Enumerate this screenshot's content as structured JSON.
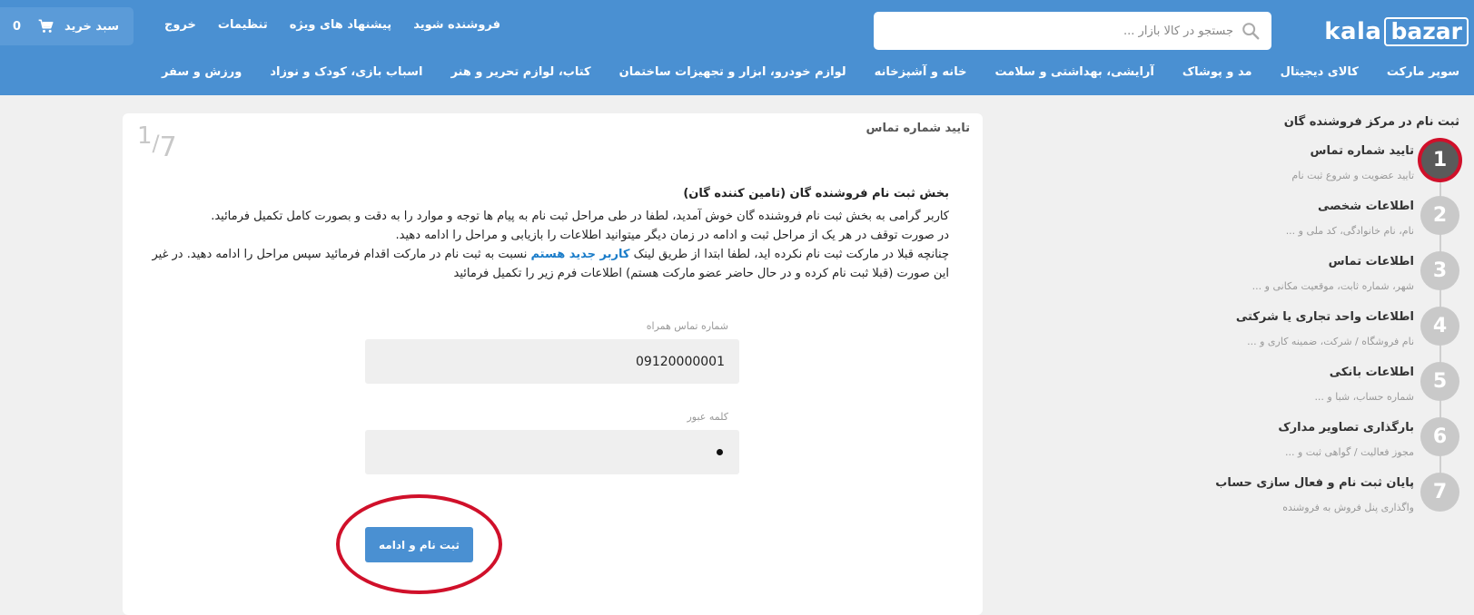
{
  "header": {
    "logo": {
      "part1": "kala",
      "part2": "bazar"
    },
    "search_placeholder": "جستجو در کالا بازار ...",
    "links": [
      "فروشنده شوید",
      "پیشنهاد های ویژه",
      "تنظیمات",
      "خروج"
    ],
    "cart": {
      "label": "سبد خرید",
      "count": "0"
    },
    "categories": [
      "سوپر مارکت",
      "کالای دیجیتال",
      "مد و پوشاک",
      "آرایشی، بهداشتی و سلامت",
      "خانه و آشپزخانه",
      "لوازم خودرو، ابزار و تجهیزات ساختمان",
      "کتاب، لوازم تحریر و هنر",
      "اسباب بازی، کودک و نوزاد",
      "ورزش و سفر"
    ]
  },
  "sidebar": {
    "title": "ثبت نام در مرکز فروشنده گان",
    "steps": [
      {
        "num": "1",
        "title": "تایید شماره تماس",
        "sub": "تایید عضویت و شروع ثبت نام"
      },
      {
        "num": "2",
        "title": "اطلاعات شخصی",
        "sub": "نام، نام خانوادگی، کد ملی و ..."
      },
      {
        "num": "3",
        "title": "اطلاعات تماس",
        "sub": "شهر، شماره ثابت، موقعیت مکانی و ..."
      },
      {
        "num": "4",
        "title": "اطلاعات واحد تجاری یا شرکتی",
        "sub": "نام فروشگاه / شرکت، ضمینه کاری و ..."
      },
      {
        "num": "5",
        "title": "اطلاعات بانکی",
        "sub": "شماره حساب، شبا و ..."
      },
      {
        "num": "6",
        "title": "بارگذاری تصاویر مدارک",
        "sub": "مجوز فعالیت / گواهی ثبت و ..."
      },
      {
        "num": "7",
        "title": "پایان ثبت نام و فعال سازی حساب",
        "sub": "واگذاری پنل فروش به فروشنده"
      }
    ],
    "active_step": 1
  },
  "main": {
    "title": "تایید شماره تماس",
    "step_current": "1",
    "step_total": "7",
    "intro_heading": "بخش ثبت نام فروشنده گان (تامین کننده گان)",
    "intro_line1": "کاربر گرامی به بخش ثبت نام فروشنده گان خوش آمدید، لطفا در طی مراحل ثبت نام به پیام ها توجه و موارد را به دقت و بصورت کامل تکمیل فرمائید.",
    "intro_line2": "در صورت توقف در هر یک از مراحل ثبت و ادامه در زمان دیگر میتوانید اطلاعات را بازیابی و مراحل را ادامه دهید.",
    "intro_line3_before": "چنانچه قبلا در مارکت ثبت نام نکرده اید، لطفا ابتدا از طریق لینک ",
    "intro_link": "کاربر جدید هستم",
    "intro_line3_after": " نسبت به ثبت نام در مارکت اقدام فرمائید سپس مراحل را ادامه دهید. در غیر این صورت (قبلا ثبت نام کرده و در حال حاضر عضو مارکت هستم) اطلاعات فرم زیر را تکمیل فرمائید",
    "phone_label": "شماره تماس همراه",
    "phone_value": "09120000001",
    "password_label": "کلمه عبور",
    "submit_label": "ثبت نام و ادامه"
  },
  "colors": {
    "header_bg": "#4a90d2",
    "accent": "#4a90d2",
    "active_step": "#5a5a5a",
    "highlight_ring": "#d0102a",
    "link": "#1a7cc9"
  }
}
